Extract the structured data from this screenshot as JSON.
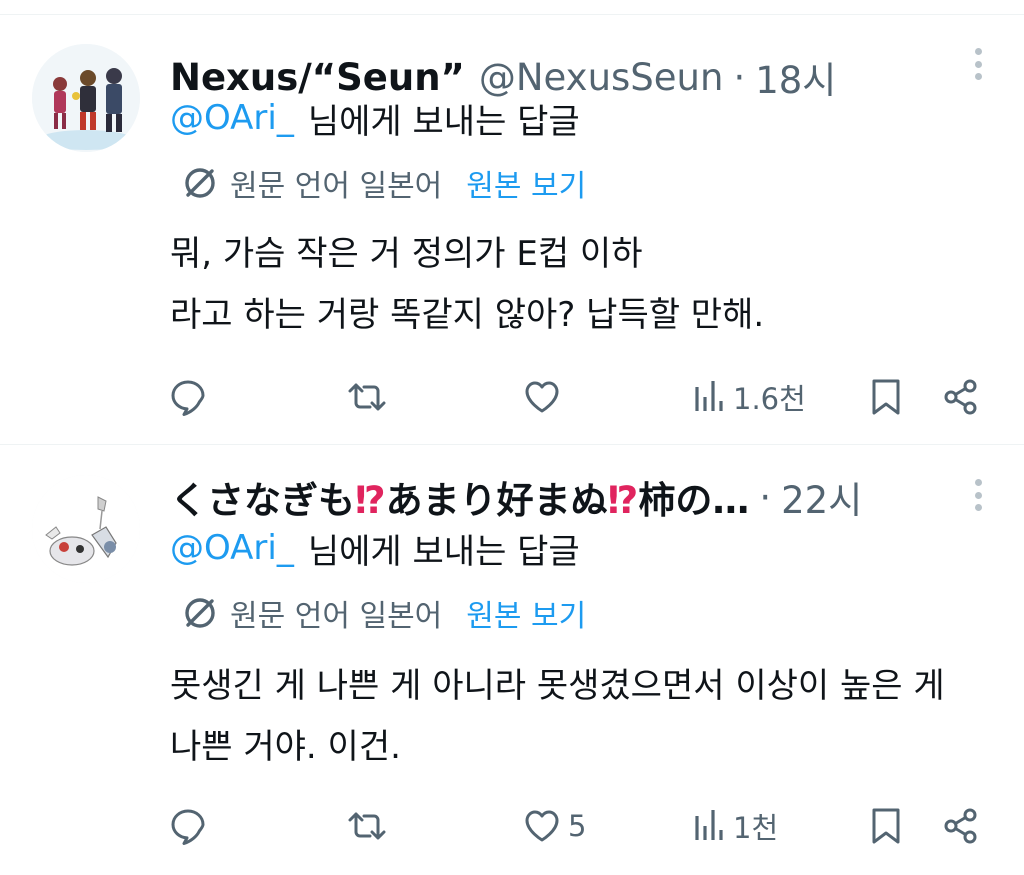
{
  "tweets": [
    {
      "display_name": "Nexus/“Seun”",
      "handle": "@NexusSeun",
      "separator": "·",
      "time": "18시",
      "reply_mention": "@OAri_",
      "reply_suffix": "님에게 보내는 답글",
      "translate_label": "원문 언어 일본어",
      "view_original": "원본 보기",
      "body_lines": [
        "뭐, 가슴 작은 거 정의가 E컵 이하",
        "라고 하는 거랑 똑같지 않아? 납득할 만해."
      ],
      "like_count": "",
      "view_count": "1.6천"
    },
    {
      "display_name_parts": [
        "くさなぎも",
        "⁉",
        "あまり好まぬ",
        "⁉",
        "柿の…"
      ],
      "handle": "",
      "separator": "·",
      "time": "22시",
      "reply_mention": "@OAri_",
      "reply_suffix": "님에게 보내는 답글",
      "translate_label": "원문 언어 일본어",
      "view_original": "원본 보기",
      "body_lines": [
        "못생긴 게 나쁜 게 아니라 못생겼으면서 이상이 높은 게",
        "나쁜 거야. 이건."
      ],
      "like_count": "5",
      "view_count": "1천"
    }
  ],
  "icons": {
    "reply": "reply-icon",
    "retweet": "retweet-icon",
    "like": "heart-icon",
    "views": "views-chart-icon",
    "bookmark": "bookmark-icon",
    "share": "share-icon",
    "translate": "translate-icon",
    "more": "more-vertical-icon"
  },
  "colors": {
    "link": "#1d9bf0",
    "muted": "#536471",
    "text": "#0f1419",
    "interrobang": "#e0245e"
  }
}
